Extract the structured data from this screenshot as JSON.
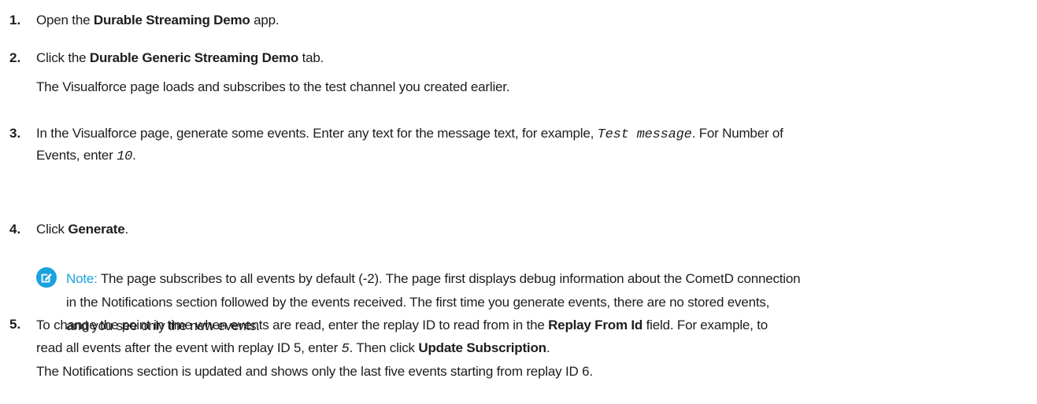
{
  "accent_color": "#1aa2dd",
  "steps": [
    {
      "number": "1.",
      "pre": "Open the ",
      "bold": "Durable Streaming Demo",
      "post": " app."
    },
    {
      "number": "2.",
      "pre": "Click the ",
      "bold": "Durable Generic Streaming Demo",
      "post": " tab.",
      "detail": "The Visualforce page loads and subscribes to the test channel you created earlier."
    },
    {
      "number": "3.",
      "line1_pre": "In the Visualforce page, generate some events. Enter any text for the message text, for example, ",
      "code1": "Test message",
      "line1_post": ". For Number of",
      "line2_pre": "Events, enter ",
      "code2": "10",
      "line2_post": "."
    },
    {
      "number": "4.",
      "pre": "Click ",
      "bold": "Generate",
      "post": "."
    },
    {
      "number": "5.",
      "line1_pre": "To change the point in time when events are read, enter the replay ID to read from in the ",
      "bold1": "Replay From Id",
      "line1_post": " field. For example, to",
      "line2_pre": "read all events after the event with replay ID 5, enter ",
      "code": "5",
      "line2_mid": ". Then click ",
      "bold2": "Update Subscription",
      "line2_post": ".",
      "detail": "The Notifications section is updated and shows only the last five events starting from replay ID 6."
    }
  ],
  "note": {
    "icon": "note-edit-icon",
    "label": "Note:",
    "line1": "The page subscribes to all events by default (-2). The page first displays debug information about the CometD connection",
    "line2": "in the Notifications section followed by the events received. The first time you generate events, there are no stored events,",
    "line3": "and you see only the new events."
  }
}
